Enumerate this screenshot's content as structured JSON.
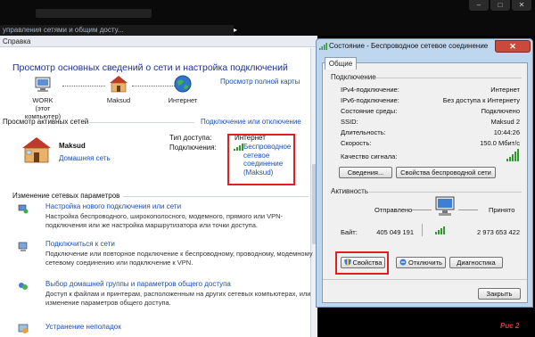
{
  "topbar": {
    "address_text": "управления сетями и общим досту...",
    "address_arrow": "▸",
    "window_buttons": [
      "–",
      "□",
      "✕"
    ]
  },
  "menubar": {
    "help_label": "Справка"
  },
  "main": {
    "title": "Просмотр основных сведений о сети и настройка подключений",
    "full_map_link": "Просмотр полной карты",
    "map": {
      "computer_name": "WORK",
      "computer_sub": "(этот компьютер)",
      "network_name": "Maksud",
      "internet_label": "Интернет"
    },
    "active_networks_header": "Просмотр активных сетей",
    "connect_disconnect_link": "Подключение или отключение",
    "network": {
      "name": "Maksud",
      "type_link": "Домашняя сеть",
      "access_type_label": "Тип доступа:",
      "access_type_value": "Интернет",
      "connections_label": "Подключения:",
      "connection_link_line1": "Беспроводное",
      "connection_link_line2": "сетевое",
      "connection_link_line3": "соединение",
      "connection_link_line4": "(Maksud)"
    },
    "change_settings_header": "Изменение сетевых параметров",
    "tasks": [
      {
        "title": "Настройка нового подключения или сети",
        "desc": "Настройка беспроводного, широкополосного, модемного, прямого или VPN-подключения или же настройка маршрутизатора или точки доступа."
      },
      {
        "title": "Подключиться к сети",
        "desc": "Подключение или повторное подключение к беспроводному, проводному, модемному сетевому соединению или подключение к VPN."
      },
      {
        "title": "Выбор домашней группы и параметров общего доступа",
        "desc": "Доступ к файлам и принтерам, расположенным на других сетевых компьютерах, или изменение параметров общего доступа."
      },
      {
        "title": "Устранение неполадок",
        "desc": ""
      }
    ]
  },
  "dialog": {
    "title": "Состояние - Беспроводное сетевое соединение",
    "close_label": "✕",
    "tab_general": "Общие",
    "connection_group": "Подключение",
    "rows": [
      {
        "label": "IPv4-подключение:",
        "value": "Интернет"
      },
      {
        "label": "IPv6-подключение:",
        "value": "Без доступа к Интернету"
      },
      {
        "label": "Состояние среды:",
        "value": "Подключено"
      },
      {
        "label": "SSID:",
        "value": "Maksud 2"
      },
      {
        "label": "Длительность:",
        "value": "10:44:26"
      },
      {
        "label": "Скорость:",
        "value": "150.0 Мбит/с"
      }
    ],
    "signal_label": "Качество сигнала:",
    "signal_bars": 5,
    "details_button": "Сведения...",
    "wireless_props_button": "Свойства беспроводной сети",
    "activity_group": "Активность",
    "sent_label": "Отправлено",
    "received_label": "Принято",
    "bytes_label": "Байт:",
    "bytes_sent": "405 049 191",
    "bytes_received": "2 973 653 422",
    "properties_button": "Свойства",
    "disconnect_button": "Отключить",
    "diagnostics_button": "Диагностика",
    "close_button": "Закрыть"
  },
  "caption": "Рис 2",
  "colors": {
    "link": "#1c4fb5",
    "title": "#1e3287",
    "highlight": "#e02020",
    "signal": "#2e9a2e"
  }
}
